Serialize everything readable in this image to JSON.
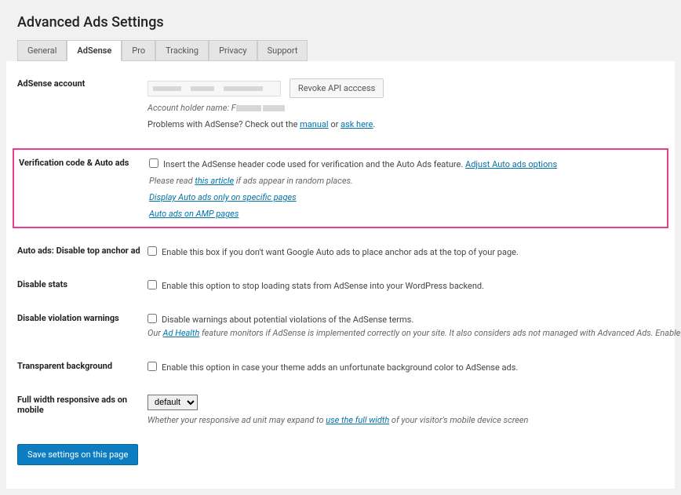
{
  "page_title": "Advanced Ads Settings",
  "tabs": [
    {
      "label": "General"
    },
    {
      "label": "AdSense"
    },
    {
      "label": "Pro"
    },
    {
      "label": "Tracking"
    },
    {
      "label": "Privacy"
    },
    {
      "label": "Support"
    }
  ],
  "sections": {
    "adsense_account": {
      "label": "AdSense account",
      "button_revoke": "Revoke API acccess",
      "holder_prefix": "Account holder name: F",
      "problems_prefix": "Problems with AdSense? Check out the ",
      "manual_link": "manual",
      "or": " or ",
      "ask_here_link": "ask here",
      "period": "."
    },
    "verification": {
      "label": "Verification code & Auto ads",
      "line1_text": " Insert the AdSense header code used for verification and the Auto Ads feature. ",
      "line1_link": "Adjust Auto ads options",
      "line2_prefix": "Please read ",
      "line2_link": "this article",
      "line2_suffix": " if ads appear in random places.",
      "link_specific": "Display Auto ads only on specific pages",
      "link_amp": "Auto ads on AMP pages"
    },
    "disable_anchor": {
      "label": "Auto ads: Disable top anchor ad",
      "text": " Enable this box if you don't want Google Auto ads to place anchor ads at the top of your page."
    },
    "disable_stats": {
      "label": "Disable stats",
      "text": " Enable this option to stop loading stats from AdSense into your WordPress backend."
    },
    "disable_violation": {
      "label": "Disable violation warnings",
      "text": " Disable warnings about potential violations of the AdSense terms.",
      "note_prefix": "Our ",
      "note_link": "Ad Health",
      "note_suffix": " feature monitors if AdSense is implemented correctly on your site. It also considers ads not managed with Advanced Ads. Enable this option to remove these checks"
    },
    "transparent_bg": {
      "label": "Transparent background",
      "text": " Enable this option in case your theme adds an unfortunate background color to AdSense ads."
    },
    "full_width": {
      "label": "Full width responsive ads on mobile",
      "select_value": "default",
      "note_prefix": "Whether your responsive ad unit may expand to ",
      "note_link": "use the full width",
      "note_suffix": " of your visitor's mobile device screen"
    }
  },
  "save_button": "Save settings on this page"
}
